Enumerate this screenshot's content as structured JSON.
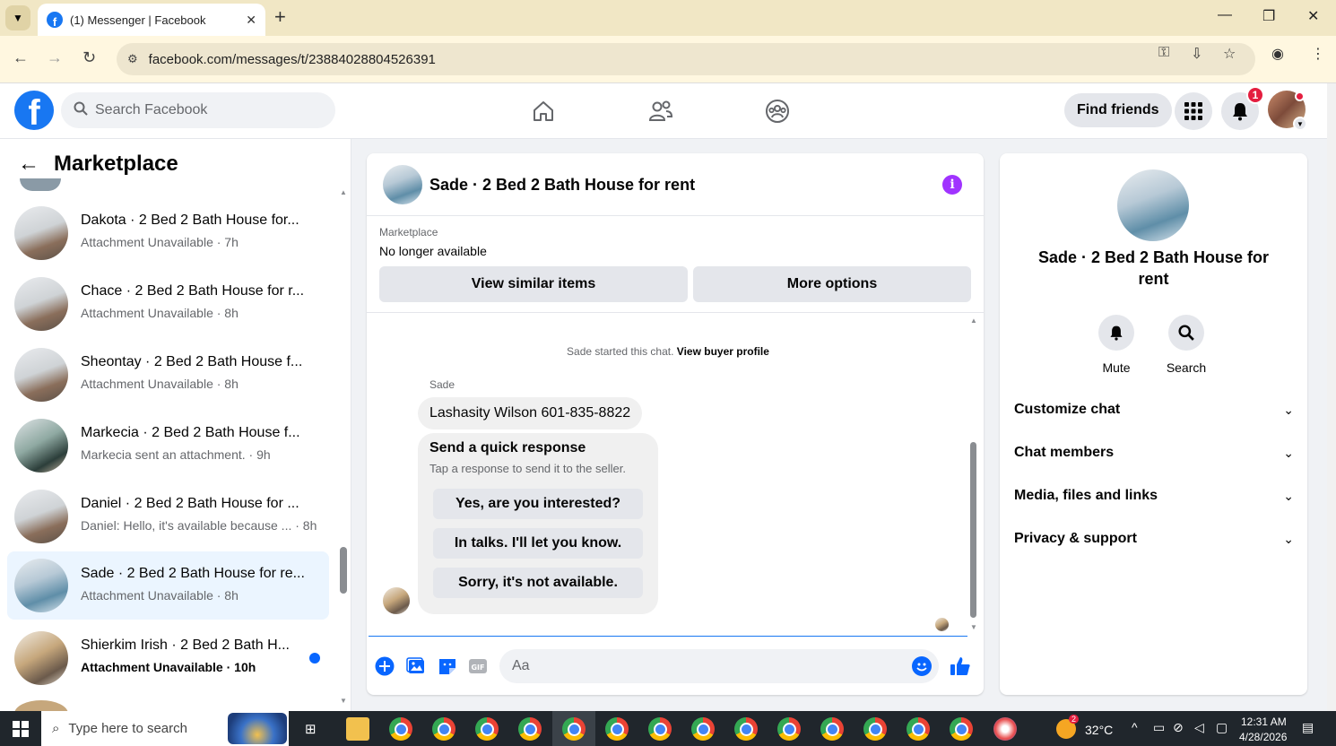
{
  "browser": {
    "tab_title": "(1) Messenger | Facebook",
    "url": "facebook.com/messages/t/23884028804526391"
  },
  "fb": {
    "search_placeholder": "Search Facebook",
    "find_friends": "Find friends",
    "notification_count": "1"
  },
  "left": {
    "title": "Marketplace",
    "conversations": [
      {
        "name": "Dakota · 2 Bed 2 Bath House for...",
        "sub": "Attachment Unavailable · 7h",
        "active": false,
        "unread": false
      },
      {
        "name": "Chace · 2 Bed 2 Bath House for r...",
        "sub": "Attachment Unavailable · 8h",
        "active": false,
        "unread": false
      },
      {
        "name": "Sheontay · 2 Bed 2 Bath House f...",
        "sub": "Attachment Unavailable · 8h",
        "active": false,
        "unread": false
      },
      {
        "name": "Markecia · 2 Bed 2 Bath House f...",
        "sub": "Markecia sent an attachment. · 9h",
        "active": false,
        "unread": false
      },
      {
        "name": "Daniel · 2 Bed 2 Bath House for ...",
        "sub": "Daniel: Hello, it's available because ... · 8h",
        "active": false,
        "unread": false
      },
      {
        "name": "Sade · 2 Bed 2 Bath House for re...",
        "sub": "Attachment Unavailable · 8h",
        "active": true,
        "unread": false
      },
      {
        "name": "Shierkim Irish · 2 Bed 2 Bath H...",
        "sub": "Attachment Unavailable · 10h",
        "active": false,
        "unread": true
      }
    ]
  },
  "chat": {
    "title": "Sade · 2 Bed 2 Bath House for rent",
    "listing_label": "Marketplace",
    "listing_status": "No longer available",
    "view_similar": "View similar items",
    "more_options": "More options",
    "started_text": "Sade started this chat.",
    "view_buyer_profile": "View buyer profile",
    "sender": "Sade",
    "message": "Lashasity Wilson 601-835-8822",
    "quick_title": "Send a quick response",
    "quick_sub": "Tap a response to send it to the seller.",
    "quick_responses": [
      "Yes, are you interested?",
      "In talks. I'll let you know.",
      "Sorry, it's not available."
    ],
    "composer_placeholder": "Aa"
  },
  "details": {
    "title": "Sade · 2 Bed 2 Bath House for rent",
    "mute": "Mute",
    "search": "Search",
    "sections": [
      "Customize chat",
      "Chat members",
      "Media, files and links",
      "Privacy & support"
    ]
  },
  "taskbar": {
    "search_placeholder": "Type here to search",
    "weather": "32°C",
    "weather_badge": "2",
    "time": "12:31 AM",
    "date": "4/28/2026"
  },
  "colors": {
    "fb_blue": "#1877f2",
    "active_row": "#ebf5ff",
    "info_purple": "#a033ff",
    "notification_red": "#e41e3f"
  }
}
